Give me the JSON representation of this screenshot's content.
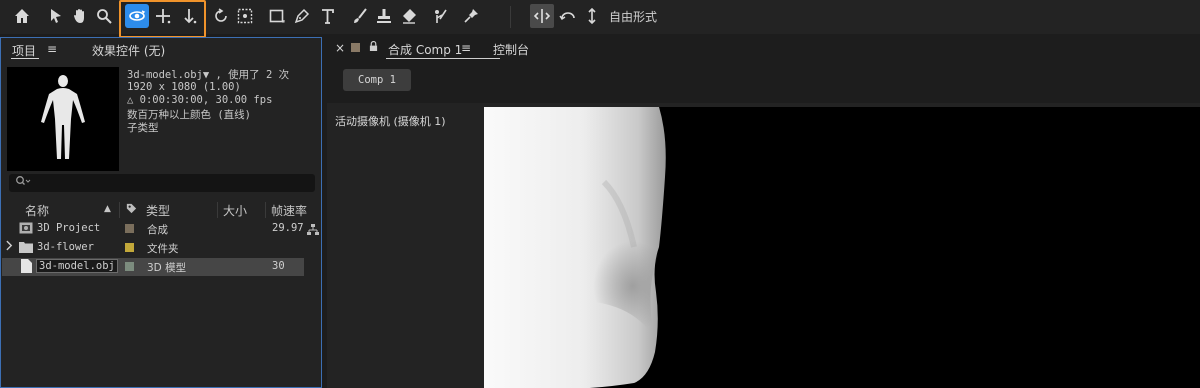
{
  "toolbar": {
    "mode_label": "自由形式",
    "icons": [
      "home-icon",
      "selection-arrow-icon",
      "hand-icon",
      "zoom-icon",
      "orbit-camera-icon",
      "pan-camera-icon",
      "dolly-camera-icon",
      "rotate-icon",
      "anchor-behind-icon",
      "rectangle-icon",
      "pen-icon",
      "type-icon",
      "brush-icon",
      "clone-stamp-icon",
      "eraser-icon",
      "roto-brush-icon",
      "puppet-pin-icon",
      "snap-icon",
      "extend-icon",
      "arrows-icon"
    ],
    "highlight_color": "#f0932b",
    "active_color": "#2d8ceb"
  },
  "project_panel": {
    "tab_project": "项目",
    "tab_menu": "≡",
    "tab_effects": "效果控件 (无)",
    "info": {
      "name": "3d-model.obj▼ , 使用了 2 次",
      "resolution": "1920 x 1080 (1.00)",
      "duration": "△ 0:00:30:00, 30.00 fps",
      "colors": "数百万种以上颜色 (直线)",
      "subtype": "子类型"
    },
    "search_placeholder": "",
    "columns": {
      "name": "名称",
      "type": "类型",
      "size": "大小",
      "fps": "帧速率"
    },
    "rows": [
      {
        "name": "3D Project",
        "type": "合成",
        "fps": "29.97",
        "swatch": "#7a6e5c",
        "icon": "composition-icon"
      },
      {
        "name": "3d-flower",
        "type": "文件夹",
        "fps": "",
        "swatch": "#c2a83a",
        "icon": "folder-icon"
      },
      {
        "name": "3d-model.obj",
        "type": "3D 模型",
        "fps": "30",
        "swatch": "#7c8c7e",
        "icon": "file-icon"
      }
    ]
  },
  "composition_panel": {
    "close": "×",
    "tab_comp": "合成 Comp 1",
    "tab_menu": "≡",
    "tab_console": "控制台",
    "comp_button": "Comp 1",
    "camera_label": "活动摄像机 (摄像机 1)"
  }
}
